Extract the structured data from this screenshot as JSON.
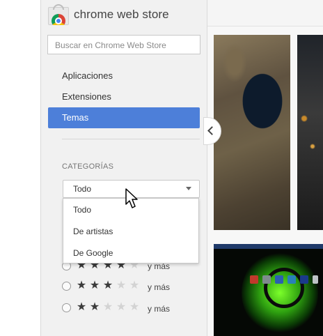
{
  "store": {
    "title": "chrome web store"
  },
  "search": {
    "placeholder": "Buscar en Chrome Web Store"
  },
  "nav": {
    "items": [
      {
        "label": "Aplicaciones",
        "active": false
      },
      {
        "label": "Extensiones",
        "active": false
      },
      {
        "label": "Temas",
        "active": true
      }
    ]
  },
  "categories": {
    "heading": "CATEGORÍAS",
    "selected": "Todo",
    "options": [
      "Todo",
      "De artistas",
      "De Google"
    ]
  },
  "ratings": {
    "suffix": "y más",
    "rows": [
      {
        "stars": 4
      },
      {
        "stars": 3
      },
      {
        "stars": 2
      }
    ]
  },
  "colors": {
    "accent": "#4d7fd9",
    "sidebar_bg": "#f1f1f1"
  },
  "icons": {
    "logo": "chrome-web-store-logo",
    "collapse": "chevron-left-icon",
    "caret": "caret-down-icon",
    "cursor": "mouse-pointer-icon"
  }
}
